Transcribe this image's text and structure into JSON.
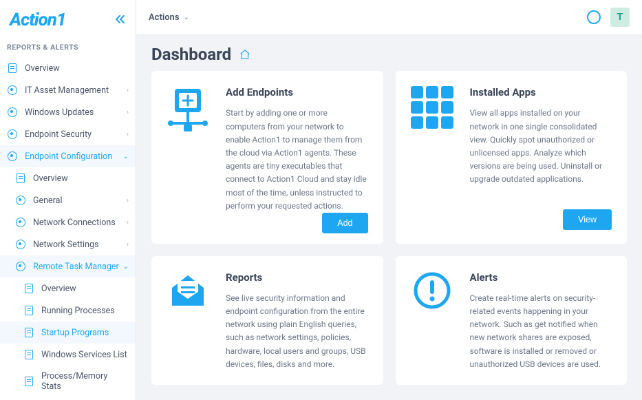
{
  "brand": "Action1",
  "topbar": {
    "actions_label": "Actions",
    "avatar_initial": "T"
  },
  "sidebar": {
    "section_title": "REPORTS & ALERTS",
    "items": [
      {
        "label": "Overview",
        "icon": "doc",
        "level": 1,
        "expandable": false
      },
      {
        "label": "IT Asset Management",
        "icon": "circle",
        "level": 1,
        "expandable": true
      },
      {
        "label": "Windows Updates",
        "icon": "circle",
        "level": 1,
        "expandable": true
      },
      {
        "label": "Endpoint Security",
        "icon": "circle",
        "level": 1,
        "expandable": true
      },
      {
        "label": "Endpoint Configuration",
        "icon": "circle",
        "level": 1,
        "expandable": true,
        "active": true,
        "open": true
      },
      {
        "label": "Overview",
        "icon": "doc",
        "level": 2
      },
      {
        "label": "General",
        "icon": "circle",
        "level": 2,
        "expandable": true
      },
      {
        "label": "Network Connections",
        "icon": "circle",
        "level": 2,
        "expandable": true
      },
      {
        "label": "Network Settings",
        "icon": "circle",
        "level": 2,
        "expandable": true
      },
      {
        "label": "Remote Task Manager",
        "icon": "circle",
        "level": 2,
        "expandable": true,
        "active": true,
        "open": true
      },
      {
        "label": "Overview",
        "icon": "doc",
        "level": 3
      },
      {
        "label": "Running Processes",
        "icon": "doc",
        "level": 3
      },
      {
        "label": "Startup Programs",
        "icon": "doc",
        "level": 3,
        "active": true
      },
      {
        "label": "Windows Services List",
        "icon": "doc",
        "level": 3
      },
      {
        "label": "Process/Memory Stats",
        "icon": "doc",
        "level": 3
      }
    ]
  },
  "page": {
    "title": "Dashboard"
  },
  "cards": [
    {
      "key": "add-endpoints",
      "title": "Add Endpoints",
      "desc": "Start by adding one or more computers from your network to enable Action1 to manage them from the cloud via Action1 agents. These agents are tiny executables that connect to Action1 Cloud and stay idle most of the time, unless instructed to perform your requested actions.",
      "button": "Add",
      "icon": "endpoint"
    },
    {
      "key": "installed-apps",
      "title": "Installed Apps",
      "desc": "View all apps installed on your network in one single consolidated view. Quickly spot unauthorized or unlicensed apps. Analyze which versions are being used. Uninstall or upgrade outdated applications.",
      "button": "View",
      "icon": "grid"
    },
    {
      "key": "reports",
      "title": "Reports",
      "desc": "See live security information and endpoint configuration from the entire network using plain English queries, such as network settings, policies, hardware, local users and groups, USB devices, files, disks and more.",
      "icon": "envelope"
    },
    {
      "key": "alerts",
      "title": "Alerts",
      "desc": "Create real-time alerts on security-related events happening in your network. Such as get notified when new network shares are exposed, software is installed or removed or unauthorized USB devices are used.",
      "icon": "alert"
    }
  ]
}
